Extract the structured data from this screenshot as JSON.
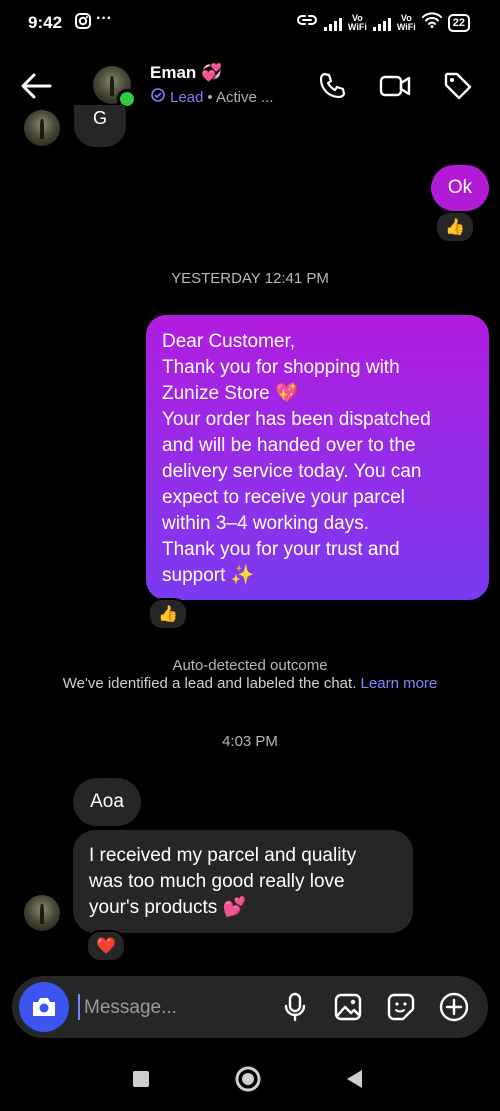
{
  "status_bar": {
    "time": "9:42",
    "more": "···",
    "vo_wifi_1": "Vo\nWiFi",
    "vo_wifi_2": "Vo\nWiFi",
    "battery": "22"
  },
  "header": {
    "contact_name": "Eman 💞",
    "label": "Lead",
    "activity": "• Active ...",
    "accent_color": "#8a7bff"
  },
  "messages": {
    "top_partial": "G",
    "ok": "Ok",
    "ok_reaction": "👍",
    "yesterday_timestamp": "YESTERDAY 12:41 PM",
    "dispatch_lines": [
      "Dear Customer,",
      "Thank you for shopping with",
      "Zunize Store 💖",
      "Your order has been dispatched",
      "and will be handed over to the",
      "delivery service today. You can",
      "expect to receive your parcel",
      "within 3–4 working days.",
      "Thank you for your trust and",
      "support ✨"
    ],
    "dispatch_reaction": "👍",
    "notice_title": "Auto-detected outcome",
    "notice_body": "We've identified a lead and labeled the chat.",
    "learn_more": "Learn more",
    "today_timestamp": "4:03 PM",
    "aoa": "Aoa",
    "received_lines": [
      "I received my parcel and quality",
      "was too much good really love",
      "your's products 💕"
    ],
    "received_reaction": "❤️"
  },
  "composer": {
    "placeholder": "Message..."
  },
  "icons": {
    "back": "back-arrow-icon",
    "call": "phone-icon",
    "video": "video-camera-icon",
    "tag": "tag-icon",
    "camera": "camera-icon",
    "mic": "microphone-icon",
    "gallery": "gallery-icon",
    "sticker": "sticker-icon",
    "add": "plus-circle-icon"
  },
  "colors": {
    "outgoing_bubble_top": "#b21ddf",
    "outgoing_bubble_bottom": "#7a3bf0",
    "incoming_bubble": "#262626",
    "camera_button": "#3c55f0",
    "online": "#2ecc40",
    "link": "#7b8cff"
  }
}
